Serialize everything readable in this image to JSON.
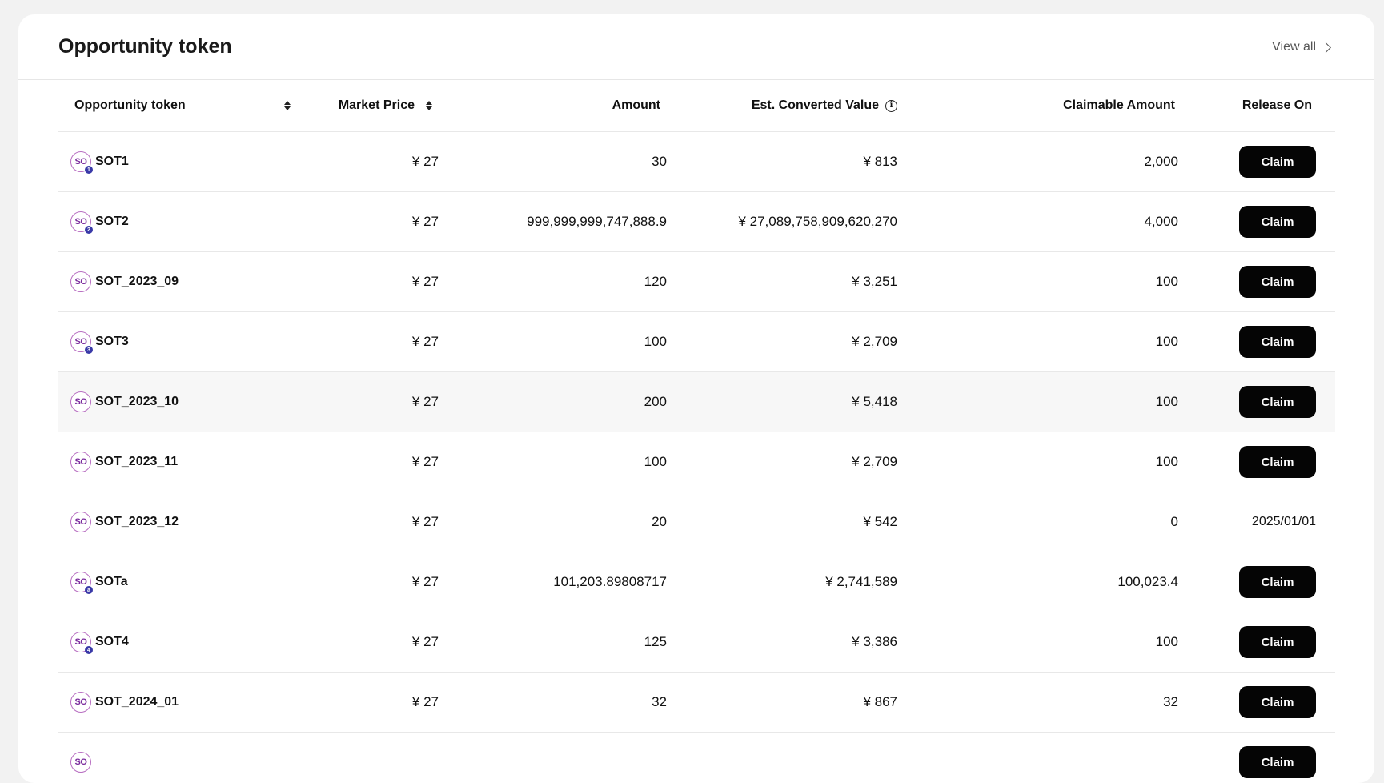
{
  "card": {
    "title": "Opportunity token",
    "view_all_label": "View all"
  },
  "table": {
    "headers": {
      "token": "Opportunity token",
      "market_price": "Market Price",
      "amount": "Amount",
      "est_value": "Est. Converted Value",
      "claimable": "Claimable Amount",
      "release_on": "Release On"
    },
    "claim_label": "Claim",
    "rows": [
      {
        "name": "SOT1",
        "badge": "1",
        "price": "¥ 27",
        "amount": "30",
        "value": "¥ 813",
        "claimable": "2,000",
        "release": "",
        "claim": true
      },
      {
        "name": "SOT2",
        "badge": "2",
        "price": "¥ 27",
        "amount": "999,999,999,747,888.9",
        "value": "¥ 27,089,758,909,620,270",
        "claimable": "4,000",
        "release": "",
        "claim": true
      },
      {
        "name": "SOT_2023_09",
        "badge": "",
        "price": "¥ 27",
        "amount": "120",
        "value": "¥ 3,251",
        "claimable": "100",
        "release": "",
        "claim": true
      },
      {
        "name": "SOT3",
        "badge": "3",
        "price": "¥ 27",
        "amount": "100",
        "value": "¥ 2,709",
        "claimable": "100",
        "release": "",
        "claim": true
      },
      {
        "name": "SOT_2023_10",
        "badge": "",
        "price": "¥ 27",
        "amount": "200",
        "value": "¥ 5,418",
        "claimable": "100",
        "release": "",
        "claim": true
      },
      {
        "name": "SOT_2023_11",
        "badge": "",
        "price": "¥ 27",
        "amount": "100",
        "value": "¥ 2,709",
        "claimable": "100",
        "release": "",
        "claim": true
      },
      {
        "name": "SOT_2023_12",
        "badge": "",
        "price": "¥ 27",
        "amount": "20",
        "value": "¥ 542",
        "claimable": "0",
        "release": "2025/01/01",
        "claim": false
      },
      {
        "name": "SOTa",
        "badge": "a",
        "price": "¥ 27",
        "amount": "101,203.89808717",
        "value": "¥ 2,741,589",
        "claimable": "100,023.4",
        "release": "",
        "claim": true
      },
      {
        "name": "SOT4",
        "badge": "4",
        "price": "¥ 27",
        "amount": "125",
        "value": "¥ 3,386",
        "claimable": "100",
        "release": "",
        "claim": true
      },
      {
        "name": "SOT_2024_01",
        "badge": "",
        "price": "¥ 27",
        "amount": "32",
        "value": "¥ 867",
        "claimable": "32",
        "release": "",
        "claim": true
      },
      {
        "name": "",
        "badge": "",
        "price": "",
        "amount": "",
        "value": "",
        "claimable": "",
        "release": "",
        "claim": true
      }
    ]
  },
  "icons": {
    "token_icon_text": "SO",
    "sort": "sort-icon",
    "info": "info-icon",
    "chevron": "chevron-right-icon"
  },
  "colors": {
    "background": "#f2f2f2",
    "card": "#ffffff",
    "button": "#050505",
    "token_ring": "#b86fc2",
    "token_text": "#7a2a9c",
    "badge": "#3a3aa8"
  }
}
